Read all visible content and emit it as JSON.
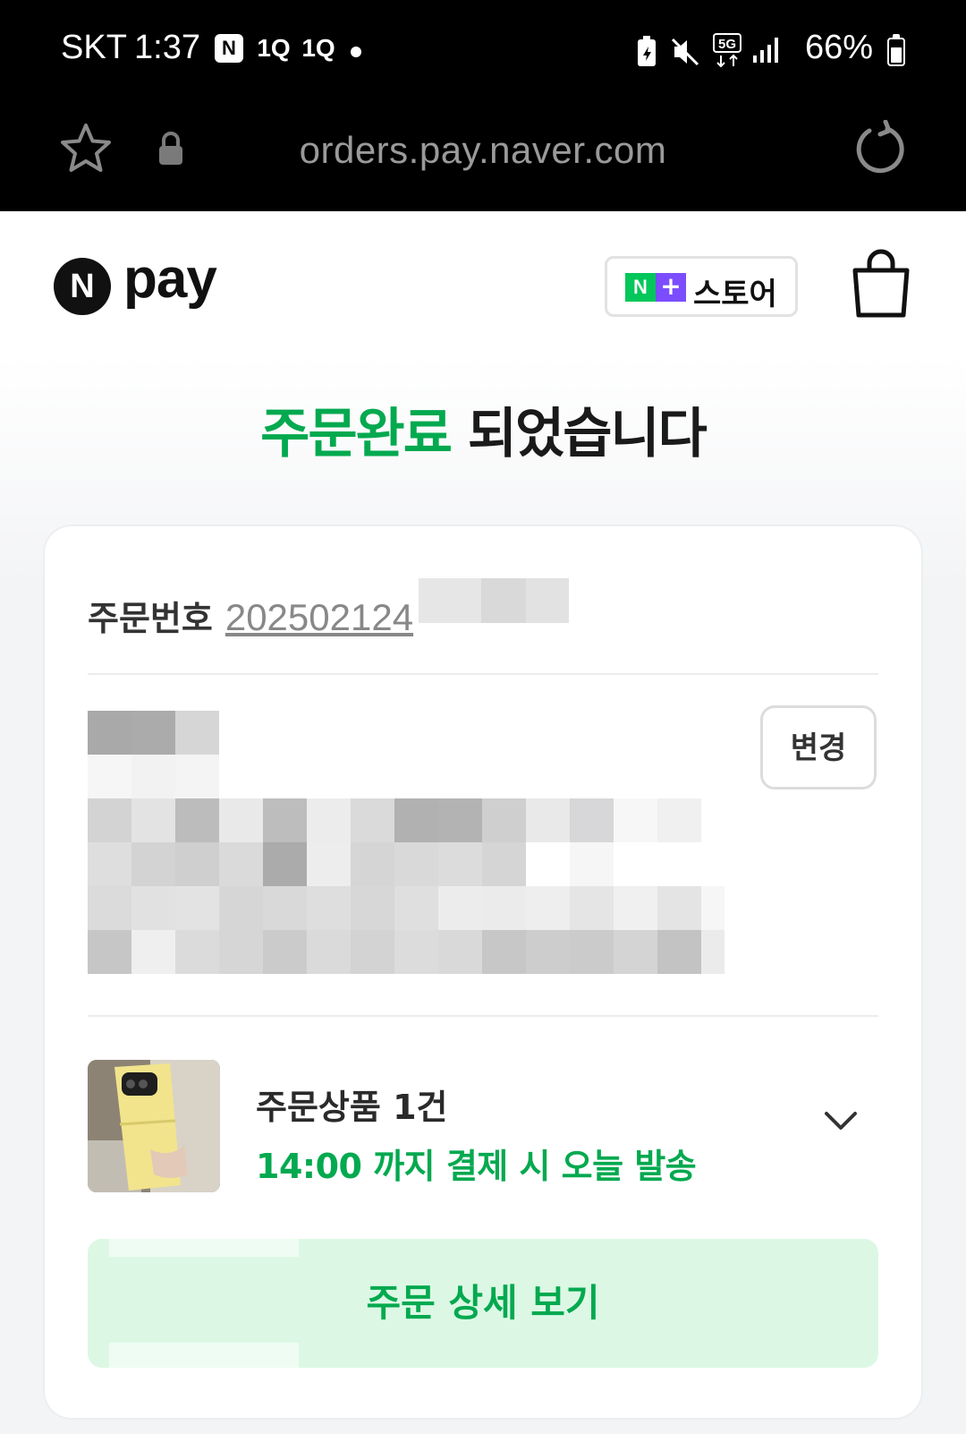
{
  "status_bar": {
    "carrier": "SKT",
    "time": "1:37",
    "notification_icons": [
      "N",
      "1Q",
      "1Q"
    ],
    "battery": "66%"
  },
  "browser": {
    "url": "orders.pay.naver.com"
  },
  "header": {
    "logo_mark": "N",
    "logo_text": "pay",
    "store_badge_n": "N",
    "store_badge_plus": "+",
    "store_label": "스토어"
  },
  "main": {
    "headline_accent": "주문완료",
    "headline_rest": " 되었습니다",
    "order_number_label": "주문번호",
    "order_number_visible": "202502124",
    "change_button": "변경",
    "item_count_label": "주문상품 1건",
    "shipping_note": "14:00 까지 결제 시 오늘 발송",
    "detail_button": "주문 상세 보기"
  },
  "colors": {
    "accent_green": "#03a94f",
    "brand_green": "#03c75a",
    "brand_purple": "#7b4dff",
    "button_bg": "#dcf8e4"
  },
  "icons": [
    "star-icon",
    "lock-icon",
    "reload-icon",
    "shopping-bag-icon",
    "chevron-down-icon"
  ]
}
